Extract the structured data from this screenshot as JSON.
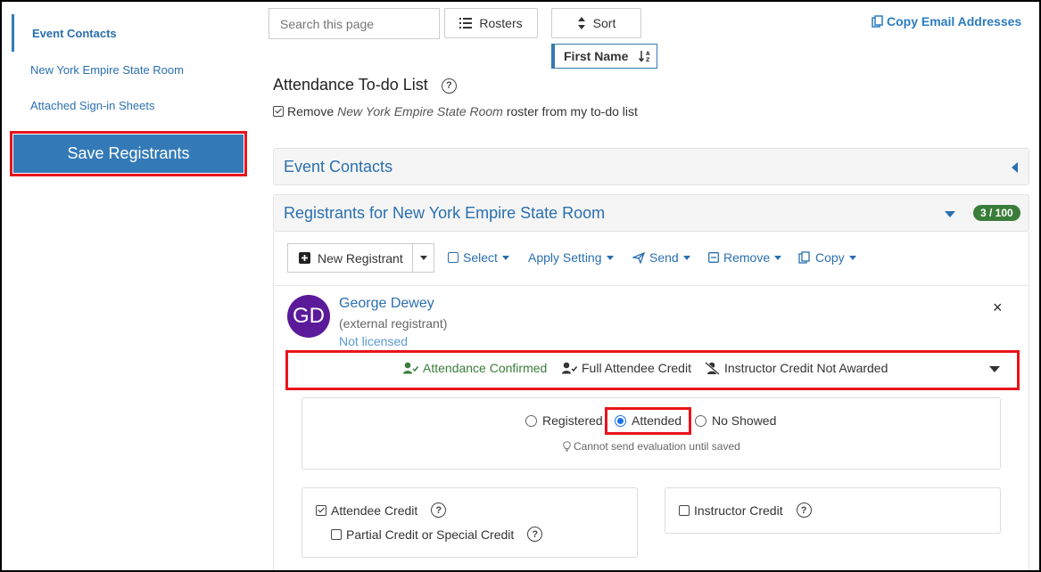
{
  "sidebar": {
    "items": [
      {
        "label": "Event Contacts",
        "active": true
      },
      {
        "label": "New York Empire State Room",
        "active": false
      },
      {
        "label": "Attached Sign-in Sheets",
        "active": false
      }
    ],
    "save_label": "Save Registrants"
  },
  "toolbar": {
    "search_placeholder": "Search this page",
    "rosters_label": "Rosters",
    "sort_label": "Sort",
    "sort_field": "First Name",
    "copy_email_label": "Copy Email Addresses"
  },
  "todo": {
    "title": "Attendance To-do List",
    "help": "?",
    "remove_prefix": "Remove",
    "remove_room": "New York Empire State Room",
    "remove_suffix": "roster from my to-do list",
    "checked": true
  },
  "panels": {
    "event_contacts_title": "Event Contacts",
    "registrants_title": "Registrants for New York Empire State Room",
    "registrants_count": "3 / 100"
  },
  "actions": {
    "new_registrant": "New Registrant",
    "select": "Select",
    "apply_setting": "Apply Setting",
    "send": "Send",
    "remove": "Remove",
    "copy": "Copy"
  },
  "registrant": {
    "initials": "GD",
    "name": "George Dewey",
    "type": "(external registrant)",
    "license": "Not licensed",
    "close": "×",
    "avatar_color": "#5a1a9a"
  },
  "status": {
    "attendance": "Attendance Confirmed",
    "attendee_credit": "Full Attendee Credit",
    "instructor_credit": "Instructor Credit Not Awarded"
  },
  "attendance": {
    "options": [
      "Registered",
      "Attended",
      "No Showed"
    ],
    "selected": "Attended",
    "hint": "Cannot send evaluation until saved"
  },
  "credits": {
    "attendee_credit": "Attendee Credit",
    "attendee_checked": true,
    "partial_credit": "Partial Credit or Special Credit",
    "instructor_credit": "Instructor Credit",
    "help": "?"
  },
  "colors": {
    "accent": "#337ab7",
    "link": "#2a6fb0",
    "highlight": "#e8141b",
    "success": "#3a7d3a"
  }
}
